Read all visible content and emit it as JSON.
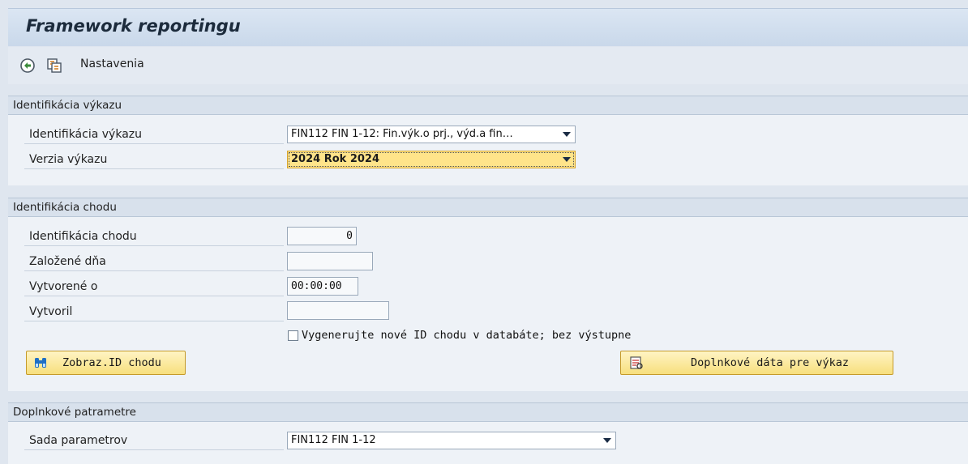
{
  "title": "Framework reportingu",
  "toolbar": {
    "execute_icon": "execute-icon",
    "copy_icon": "variant-icon",
    "settings_label": "Nastavenia"
  },
  "section_report": {
    "header": "Identifikácia výkazu",
    "report_id_label": "Identifikácia výkazu",
    "report_id_value": "FIN112 FIN 1-12: Fin.výk.o prj., výd.a fin…",
    "report_version_label": "Verzia výkazu",
    "report_version_value": "2024 Rok 2024"
  },
  "section_run": {
    "header": "Identifikácia chodu",
    "run_id_label": "Identifikácia chodu",
    "run_id_value": "0",
    "created_on_label": "Založené dňa",
    "created_on_value": "",
    "created_at_label": "Vytvorené o",
    "created_at_value": "00:00:00",
    "created_by_label": "Vytvoril",
    "created_by_value": "",
    "checkbox_label": "Vygenerujte nové ID chodu v databáte; bez výstupne",
    "show_run_button": "Zobraz.ID chodu",
    "additional_data_button": "Doplnkové dáta pre výkaz"
  },
  "section_params": {
    "header": "Doplnkové patrametre",
    "param_set_label": "Sada parametrov",
    "param_set_value": "FIN112 FIN 1-12"
  },
  "colors": {
    "button_fill": "#f7df7d",
    "highlight_fill": "#ffe48a",
    "section_header": "#d8e1ec"
  }
}
